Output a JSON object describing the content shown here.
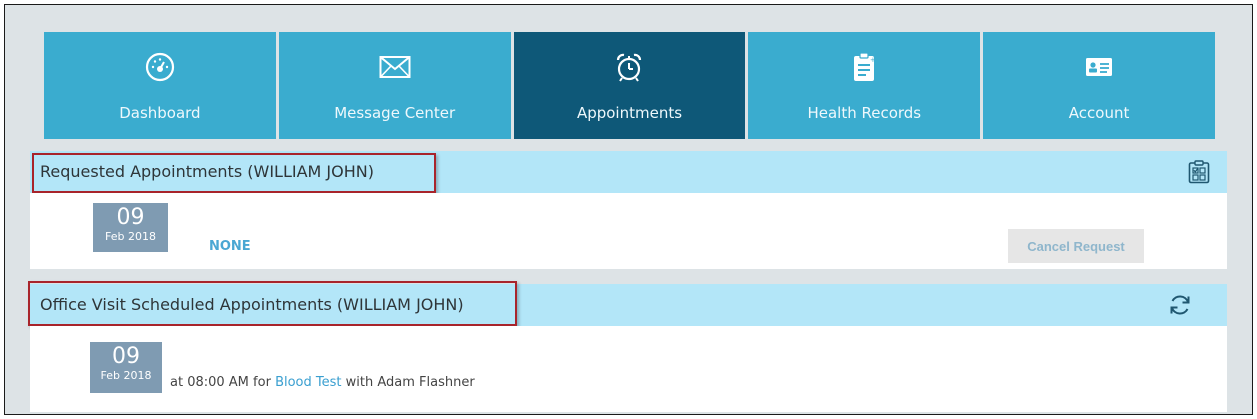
{
  "nav": {
    "tabs": [
      {
        "label": "Dashboard",
        "icon": "dashboard-icon",
        "active": false
      },
      {
        "label": "Message Center",
        "icon": "envelope-icon",
        "active": false
      },
      {
        "label": "Appointments",
        "icon": "alarm-clock-icon",
        "active": true
      },
      {
        "label": "Health Records",
        "icon": "clipboard-icon",
        "active": false
      },
      {
        "label": "Account",
        "icon": "id-card-icon",
        "active": false
      }
    ]
  },
  "requested": {
    "title": "Requested Appointments (WILLIAM JOHN)",
    "date_day": "09",
    "date_month": "Feb 2018",
    "status": "NONE",
    "cancel_label": "Cancel Request",
    "header_icon": "checklist-calendar-icon"
  },
  "scheduled": {
    "title": "Office Visit Scheduled Appointments (WILLIAM JOHN)",
    "date_day": "09",
    "date_month": "Feb 2018",
    "time_text": "at 08:00 AM",
    "for_text": "for",
    "appointment_type": "Blood Test",
    "with_text": "with Adam Flashner",
    "header_icon": "refresh-icon"
  },
  "colors": {
    "nav_tab": "#3aaccf",
    "nav_tab_active": "#0e5878",
    "section_header": "#b3e6f8",
    "date_box": "#7f9bb2",
    "link": "#3a9fd0",
    "highlight_border": "#a8242b"
  }
}
